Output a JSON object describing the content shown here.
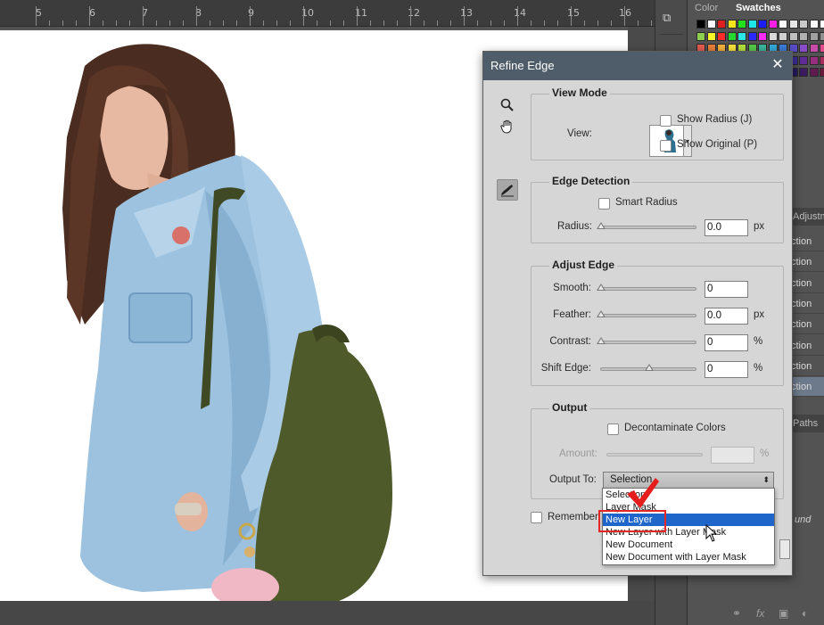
{
  "ruler": {
    "labels": [
      "5",
      "6",
      "7",
      "8",
      "9",
      "10",
      "11",
      "12",
      "13",
      "14",
      "15",
      "16"
    ]
  },
  "panels": {
    "tabs": [
      "Color",
      "Swatches"
    ],
    "active_tab": "Swatches",
    "adjustments_tab": "Adjustm",
    "layer_row_labels": [
      "ction",
      "ction",
      "ction",
      "ction",
      "ction",
      "ction",
      "ction",
      "ction"
    ],
    "paths_tab": "Paths",
    "layer_row_italic": "und",
    "swatch_colors": [
      [
        "#000000",
        "#ffffff",
        "#dc1f1f",
        "#f5e51a",
        "#24e01c",
        "#1ee6e6",
        "#1c1cff",
        "#ff1fe4",
        "#ffffff",
        "#e6e6e6",
        "#c8c8c8",
        "#ffffff",
        "#ffffff",
        "#ffffff",
        "#ffffff"
      ],
      [
        "#8ecf4f",
        "#f5f52a",
        "#ff2a2a",
        "#26d92e",
        "#2ae6e6",
        "#2a2aff",
        "#ff2aff",
        "#d8d8d8",
        "#cfcfcf",
        "#c0c0c0",
        "#b0b0b0",
        "#a0a0a0",
        "#909090",
        "#808080",
        "#707070"
      ],
      [
        "#e25a4f",
        "#e67e3b",
        "#f3b03a",
        "#f6e23a",
        "#b5e03c",
        "#54c84a",
        "#3ab49c",
        "#34a8d8",
        "#3a7ad8",
        "#5a4cc6",
        "#8a4cc6",
        "#c64ca8",
        "#e24a8a",
        "#e24a5a",
        "#d84040"
      ],
      [
        "#b02a2a",
        "#b04e1e",
        "#b87a1c",
        "#b8a81c",
        "#7aa81c",
        "#2a9026",
        "#1e8a72",
        "#1c7aa8",
        "#1c4ea8",
        "#3a2c98",
        "#602c98",
        "#982c7e",
        "#a82c5c",
        "#a82c3a",
        "#902020"
      ],
      [
        "#701818",
        "#703010",
        "#764c10",
        "#766c10",
        "#4c6c10",
        "#185a16",
        "#105646",
        "#104c6a",
        "#10306a",
        "#241a60",
        "#3c1a60",
        "#601a50",
        "#6a1a3a",
        "#6a1a24",
        "#501010"
      ]
    ]
  },
  "dialog": {
    "title": "Refine Edge",
    "close_symbol": "✕",
    "view_mode": {
      "heading": "View Mode",
      "view_label": "View:",
      "show_radius": "Show Radius (J)",
      "show_original": "Show Original (P)"
    },
    "edge_detection": {
      "heading": "Edge Detection",
      "smart_radius": "Smart Radius",
      "radius_label": "Radius:",
      "radius_value": "0.0",
      "radius_unit": "px"
    },
    "adjust_edge": {
      "heading": "Adjust Edge",
      "rows": [
        {
          "label": "Smooth:",
          "value": "0",
          "unit": "",
          "level": 0
        },
        {
          "label": "Feather:",
          "value": "0.0",
          "unit": "px",
          "level": 0
        },
        {
          "label": "Contrast:",
          "value": "0",
          "unit": "%",
          "level": 0
        },
        {
          "label": "Shift Edge:",
          "value": "0",
          "unit": "%",
          "level": 0.5
        }
      ]
    },
    "output": {
      "heading": "Output",
      "decontaminate": "Decontaminate Colors",
      "amount_label": "Amount:",
      "amount_unit": "%",
      "output_to_label": "Output To:",
      "output_to_value": "Selection",
      "remember_label": "Remember S"
    }
  },
  "dropdown": {
    "options": [
      "Selection",
      "Layer Mask",
      "New Layer",
      "New Layer with Layer Mask",
      "New Document",
      "New Document with Layer Mask"
    ],
    "highlighted_index": 2
  }
}
